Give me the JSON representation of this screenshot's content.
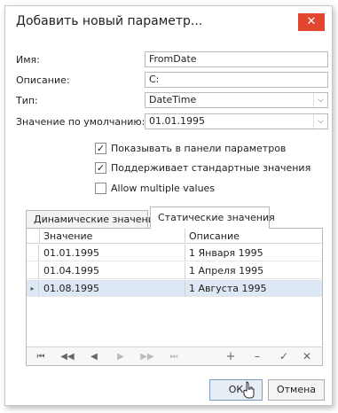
{
  "dialog": {
    "title": "Добавить новый параметр...",
    "close_glyph": "✕"
  },
  "form": {
    "name_label": "Имя:",
    "name_value": "FromDate",
    "description_label": "Описание:",
    "description_value": "C:",
    "type_label": "Тип:",
    "type_value": "DateTime",
    "default_label": "Значение по умолчанию:",
    "default_value": "01.01.1995"
  },
  "options": {
    "show_in_panel": {
      "label": "Показывать в панели параметров",
      "checked": true
    },
    "supports_standard": {
      "label": "Поддерживает стандартные значения",
      "checked": true
    },
    "allow_multiple": {
      "label": "Allow multiple values",
      "checked": false
    }
  },
  "tabs": {
    "dynamic": "Динамические значения",
    "static": "Статические значения",
    "active": "static"
  },
  "grid": {
    "columns": [
      "Значение",
      "Описание"
    ],
    "rows": [
      {
        "value": "01.01.1995",
        "description": "1 Января 1995"
      },
      {
        "value": "01.04.1995",
        "description": "1 Апреля 1995"
      },
      {
        "value": "01.08.1995",
        "description": "1 Августа 1995"
      }
    ],
    "selected_row": 2,
    "row_indicator": "▸"
  },
  "navigator": {
    "first": "⏮",
    "prev_page": "◀◀",
    "prev": "◀",
    "next": "▶",
    "next_page": "▶▶",
    "last": "⏭",
    "add": "+",
    "remove": "–",
    "apply": "✓",
    "cancel": "✕"
  },
  "buttons": {
    "ok": "ОК",
    "cancel": "Отмена"
  },
  "dropdown_glyph": "⌵"
}
